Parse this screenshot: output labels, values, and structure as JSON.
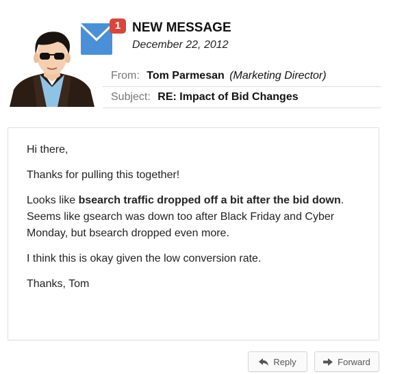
{
  "header": {
    "badge_count": "1",
    "title": "NEW MESSAGE",
    "date": "December 22, 2012"
  },
  "meta": {
    "from_label": "From:",
    "from_name": "Tom Parmesan",
    "from_role": "(Marketing Director)",
    "subject_label": "Subject:",
    "subject": "RE: Impact of Bid Changes"
  },
  "body": {
    "greeting": "Hi there,",
    "thanks": "Thanks for pulling this together!",
    "p3_pre": "Looks like ",
    "p3_bold": "bsearch traffic dropped off a bit after the bid down",
    "p3_post": ". Seems like gsearch was down too after Black Friday and Cyber Monday, but bsearch dropped even more.",
    "p4": "I think this is okay given the low conversion rate.",
    "signoff": "Thanks, Tom"
  },
  "actions": {
    "reply_label": "Reply",
    "forward_label": "Forward"
  },
  "icons": {
    "avatar": "man-with-sunglasses-avatar",
    "mail": "envelope-icon",
    "reply": "reply-arrow-icon",
    "forward": "forward-arrow-icon"
  },
  "colors": {
    "envelope": "#4a90d9",
    "badge": "#d9453b"
  }
}
